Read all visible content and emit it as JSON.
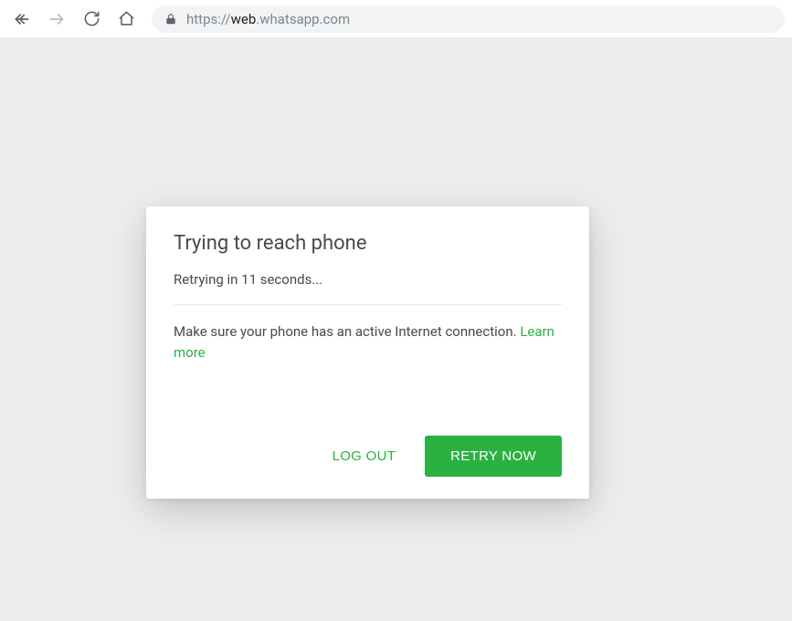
{
  "toolbar": {
    "url_proto": "https://",
    "url_host": "web",
    "url_path": ".whatsapp.com"
  },
  "dialog": {
    "title": "Trying to reach phone",
    "subtitle": "Retrying in 11 seconds...",
    "body_text": "Make sure your phone has an active Internet connection. ",
    "learn_more": "Learn more",
    "logout_label": "LOG OUT",
    "retry_label": "RETRY NOW"
  },
  "colors": {
    "accent": "#2bb140",
    "page_bg": "#ededed"
  }
}
